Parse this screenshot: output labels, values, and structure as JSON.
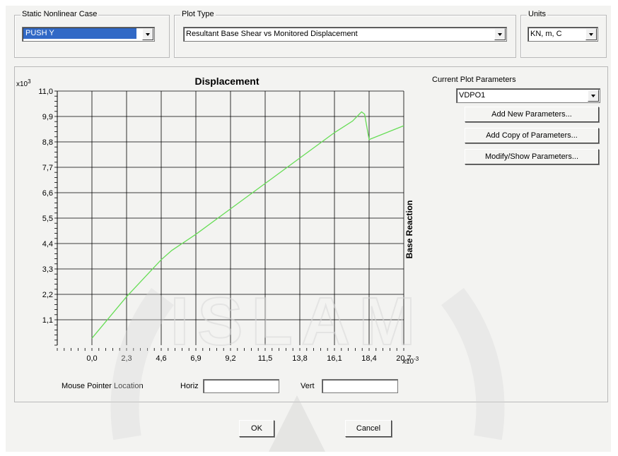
{
  "case_group": {
    "title": "Static Nonlinear Case",
    "value": "PUSH Y"
  },
  "plot_type_group": {
    "title": "Plot Type",
    "value": "Resultant Base Shear vs Monitored Displacement"
  },
  "units_group": {
    "title": "Units",
    "value": "KN, m, C"
  },
  "params": {
    "title": "Current Plot Parameters",
    "selected": "VDPO1",
    "add_new": "Add New Parameters...",
    "add_copy": "Add Copy of Parameters...",
    "modify": "Modify/Show Parameters..."
  },
  "mouse": {
    "label": "Mouse Pointer Location",
    "horiz_label": "Horiz",
    "vert_label": "Vert",
    "horiz_value": "",
    "vert_value": ""
  },
  "buttons": {
    "ok": "OK",
    "cancel": "Cancel"
  },
  "watermark": "ISLAM",
  "colors": {
    "curve": "#66dd55",
    "grid": "#000000",
    "selection": "#3169c6",
    "dialog": "#f3f3f1"
  },
  "chart_data": {
    "type": "line",
    "title": "Displacement",
    "xlabel": "",
    "ylabel": "Base Reaction",
    "x_multiplier": "x10-3",
    "y_multiplier": "x103",
    "xlim": [
      -2.3,
      20.7
    ],
    "ylim": [
      0,
      11.0
    ],
    "x_ticks": [
      "0.0",
      "2.3",
      "4.6",
      "6.9",
      "9.2",
      "11.5",
      "13.8",
      "16.1",
      "18.4",
      "20.7"
    ],
    "y_ticks": [
      "1.1",
      "2.2",
      "3.3",
      "4.4",
      "5.5",
      "6.6",
      "7.7",
      "8.8",
      "9.9",
      "11.0"
    ],
    "grid": true,
    "series": [
      {
        "x": [
          0.0,
          2.3,
          4.6,
          5.3,
          6.9,
          9.2,
          11.5,
          13.8,
          16.1,
          17.3,
          17.9,
          18.1,
          18.4,
          20.7
        ],
        "y": [
          0.3,
          2.1,
          3.7,
          4.1,
          4.8,
          5.9,
          7.0,
          8.1,
          9.2,
          9.7,
          10.1,
          10.0,
          8.9,
          9.5
        ]
      }
    ]
  }
}
